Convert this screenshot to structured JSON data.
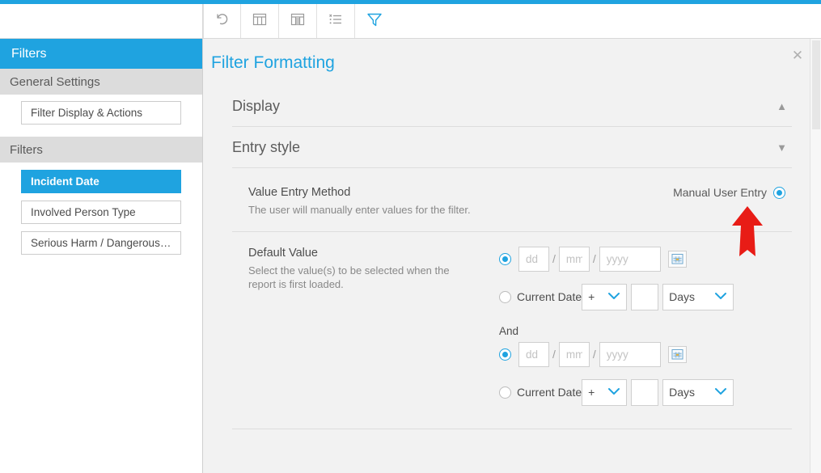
{
  "theme": {
    "accent": "#1fa3e0",
    "panel_bg": "#f2f2f2",
    "section_bg": "#dcdcdc",
    "annotation_red": "#e81c16"
  },
  "toolbar": {
    "buttons": [
      {
        "name": "undo-icon",
        "label": "Undo"
      },
      {
        "name": "table-icon",
        "label": "Table"
      },
      {
        "name": "column-icon",
        "label": "Column"
      },
      {
        "name": "list-icon",
        "label": "List"
      },
      {
        "name": "filter-icon",
        "label": "Filter"
      }
    ]
  },
  "sidebar": {
    "active_header": "Filters",
    "sections": [
      {
        "title": "General Settings",
        "items": [
          {
            "label": "Filter Display & Actions",
            "selected": false
          }
        ]
      },
      {
        "title": "Filters",
        "items": [
          {
            "label": "Incident Date",
            "selected": true
          },
          {
            "label": "Involved Person Type",
            "selected": false
          },
          {
            "label": "Serious Harm / Dangerous…",
            "selected": false
          }
        ]
      }
    ]
  },
  "panel": {
    "title": "Filter Formatting",
    "close_label": "✕",
    "accordions": [
      {
        "label": "Display",
        "chevron": "▲",
        "expanded": true
      },
      {
        "label": "Entry style",
        "chevron": "▼",
        "expanded": false
      }
    ],
    "value_entry_method": {
      "label": "Value Entry Method",
      "description": "The user will manually enter values for the filter.",
      "option_label": "Manual User Entry",
      "selected": true
    },
    "default_value": {
      "label": "Default Value",
      "description": "Select the value(s) to be selected when the report is first loaded.",
      "and_label": "And",
      "groups": [
        {
          "date_radio_selected": true,
          "day_placeholder": "dd",
          "day_value": "",
          "month_placeholder": "mm",
          "month_value": "",
          "year_placeholder": "yyyy",
          "year_value": "",
          "separator": "/",
          "calendar_icon": "calendar-icon",
          "current_date_radio_selected": false,
          "current_date_label": "Current Date",
          "operator_value": "+",
          "amount_value": "",
          "unit_value": "Days"
        },
        {
          "date_radio_selected": true,
          "day_placeholder": "dd",
          "day_value": "",
          "month_placeholder": "mm",
          "month_value": "",
          "year_placeholder": "yyyy",
          "year_value": "",
          "separator": "/",
          "calendar_icon": "calendar-icon",
          "current_date_radio_selected": false,
          "current_date_label": "Current Date",
          "operator_value": "+",
          "amount_value": "",
          "unit_value": "Days"
        }
      ]
    }
  },
  "annotation": {
    "type": "red-up-arrow",
    "points_at": "Manual User Entry radio button"
  }
}
